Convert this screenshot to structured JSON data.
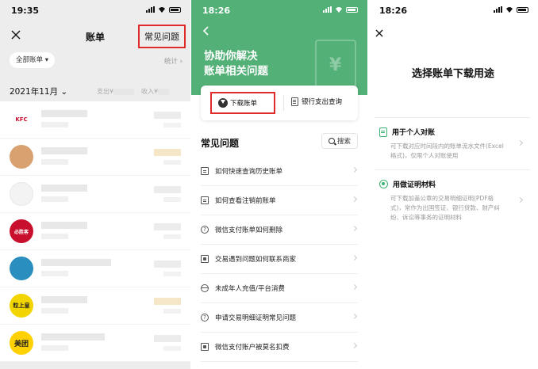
{
  "panel1": {
    "status_time": "19:35",
    "nav_title": "账单",
    "faq_link": "常见问题",
    "filter_label": "全部账单",
    "stats_link": "统计",
    "month": "2021年11月",
    "expense_label": "支出¥",
    "income_label": "收入¥",
    "merchants": [
      {
        "icon": "kfc-logo",
        "text": "KFC"
      },
      {
        "icon": "dog-avatar",
        "text": ""
      },
      {
        "icon": "white-avatar",
        "text": ""
      },
      {
        "icon": "bishengke-logo",
        "text": "必胜客"
      },
      {
        "icon": "blue-logo",
        "text": ""
      },
      {
        "icon": "yellow-logo",
        "text": "粒上皇"
      },
      {
        "icon": "meituan-logo",
        "text": "美团"
      }
    ]
  },
  "panel2": {
    "status_time": "18:26",
    "hero_line1": "协助你解决",
    "hero_line2": "账单相关问题",
    "download_label": "下载账单",
    "bank_label": "银行支出查询",
    "faq_title": "常见问题",
    "search_label": "搜索",
    "faq_items": [
      {
        "icon": "doc",
        "label": "如何快速查询历史账单"
      },
      {
        "icon": "doc",
        "label": "如何查看注销前账单"
      },
      {
        "icon": "q",
        "label": "微信支付账单如何删除"
      },
      {
        "icon": "bag",
        "label": "交易遇到问题如何联系商家"
      },
      {
        "icon": "kid",
        "label": "未成年人充值/平台消费"
      },
      {
        "icon": "q",
        "label": "申请交易明细证明常见问题"
      },
      {
        "icon": "bag",
        "label": "微信支付账户被莫名扣费"
      }
    ]
  },
  "panel3": {
    "status_time": "18:26",
    "title": "选择账单下载用途",
    "option1_title": "用于个人对账",
    "option1_desc": "可下载对应时间段内的账单流水文件(Excel格式)，仅限个人对账使用",
    "option2_title": "用做证明材料",
    "option2_desc": "可下载加盖公章的交易明细证明(PDF格式)，常作为出国签证、银行贷款、财产纠纷、诉讼等事务的证明材料"
  },
  "colors": {
    "wechat_green": "#53b077",
    "highlight_red": "#e02b2b",
    "accent_green": "#3cb371"
  }
}
